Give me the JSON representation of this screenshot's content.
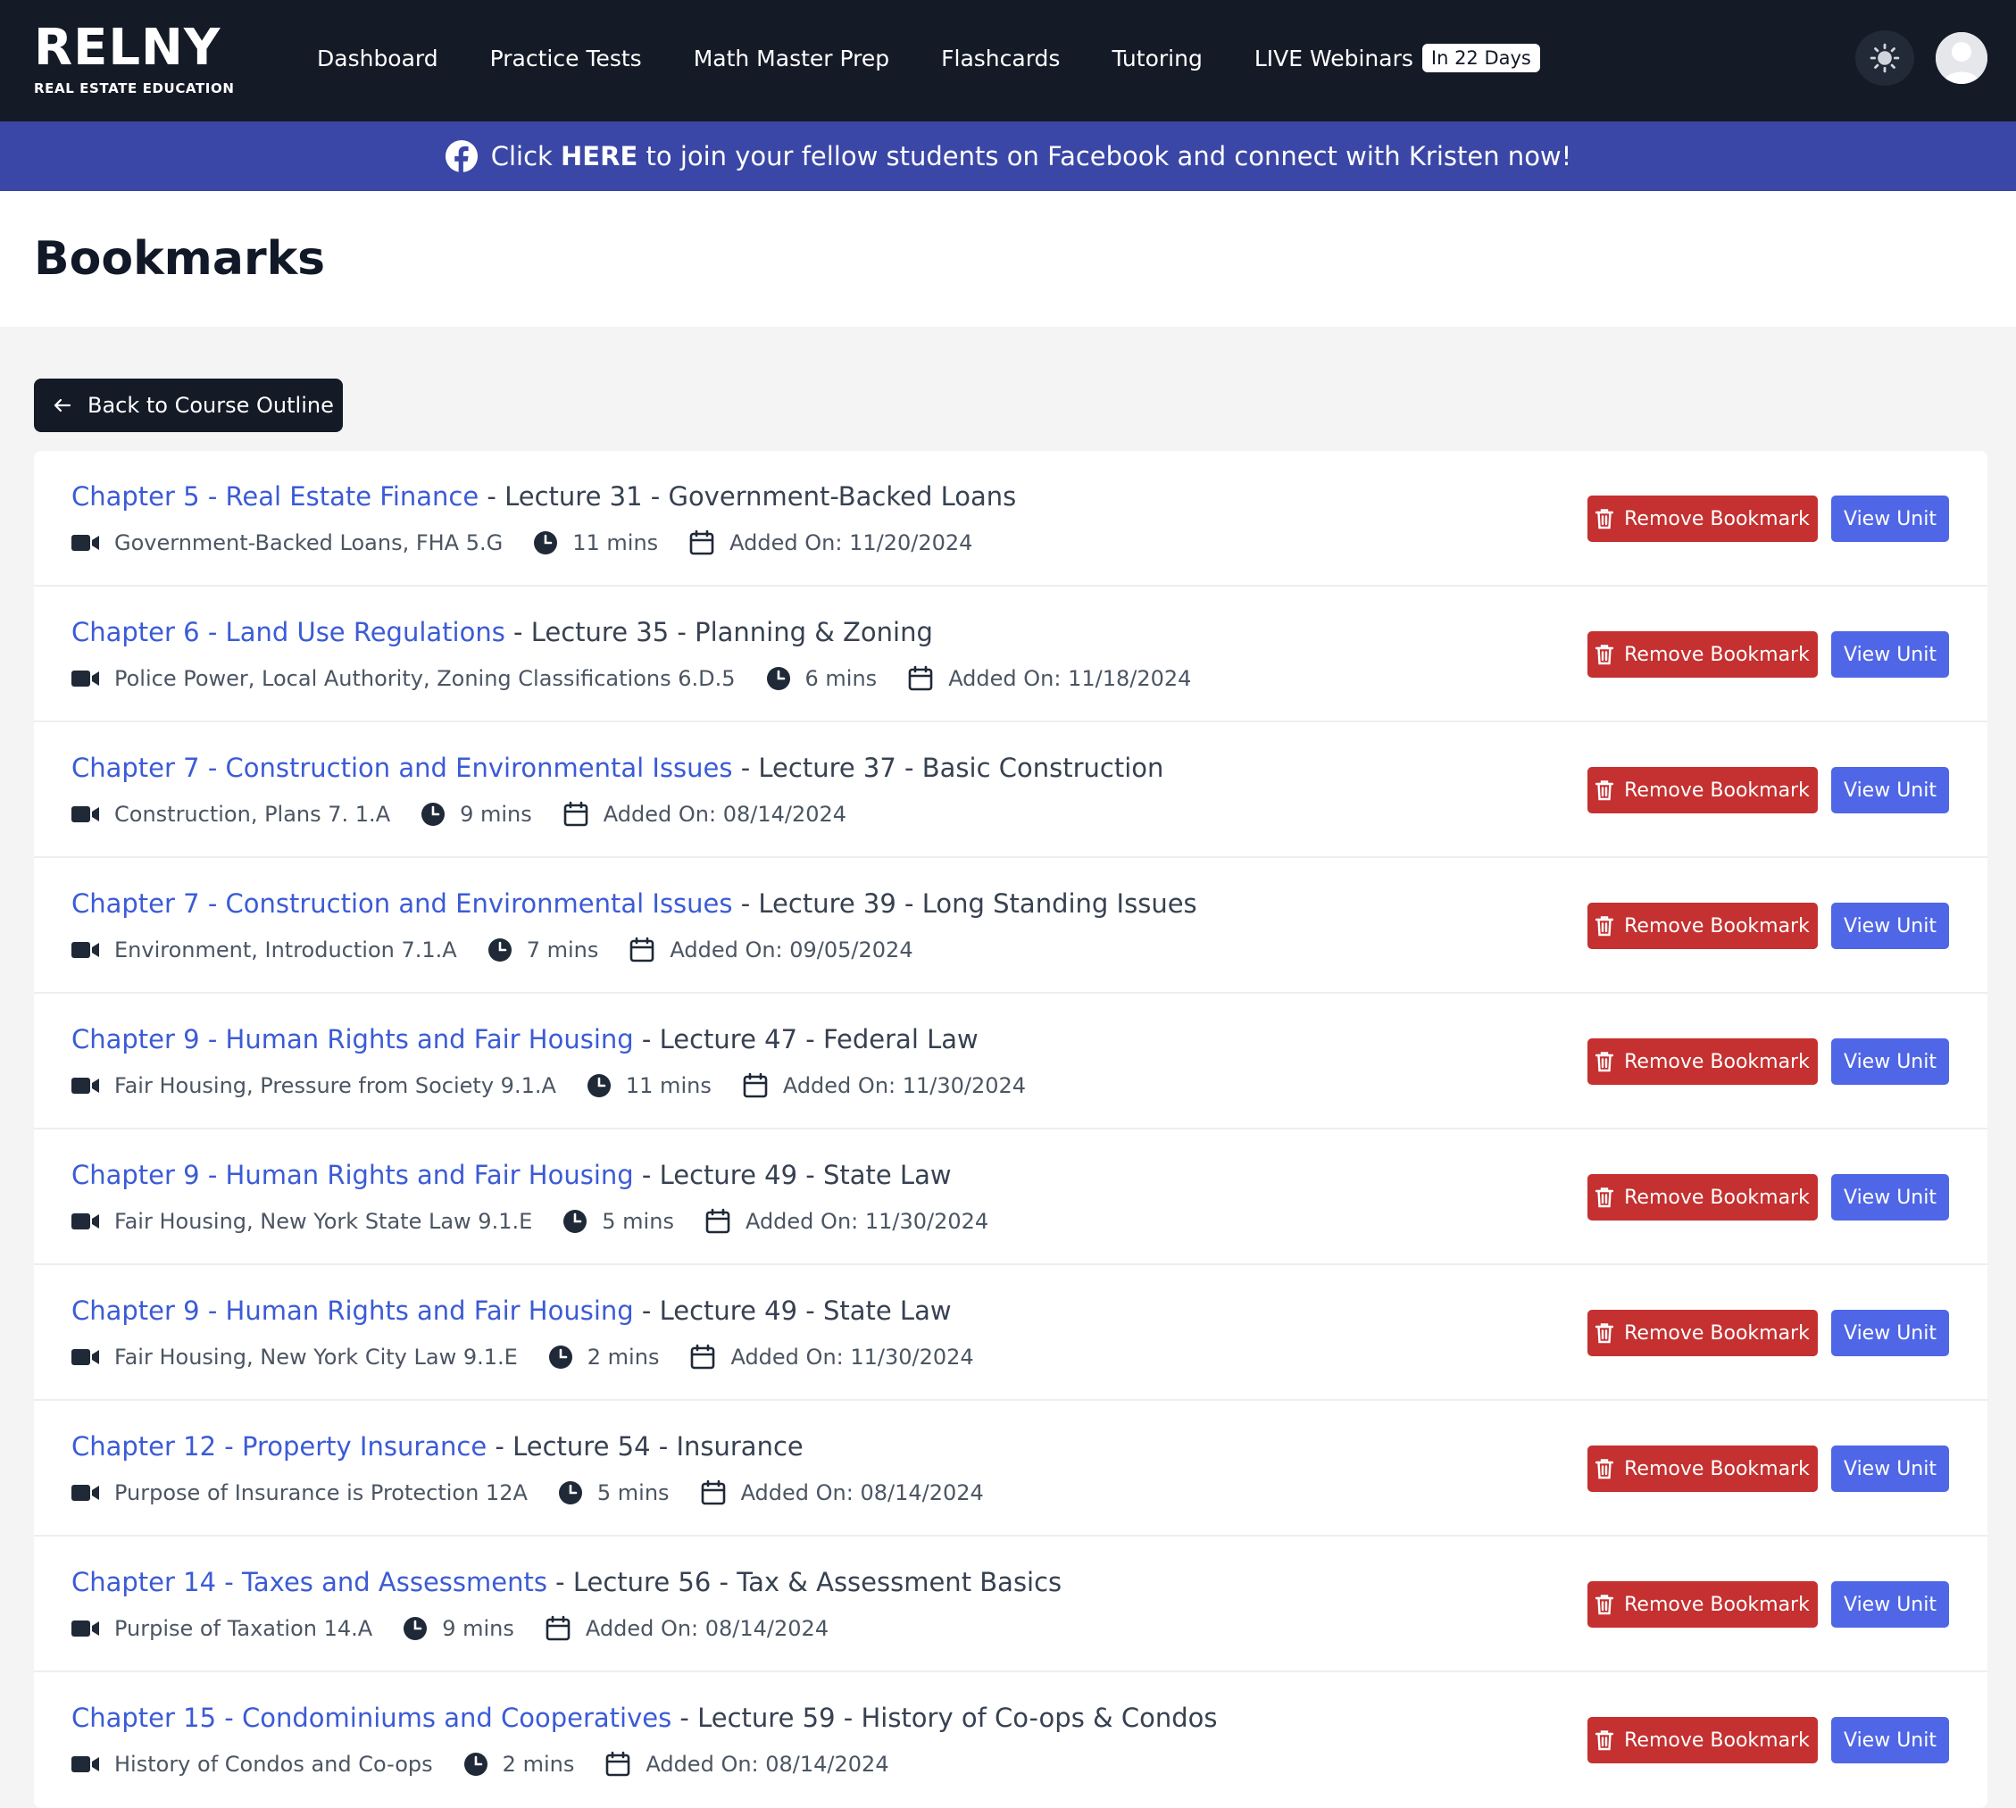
{
  "brand": {
    "name": "RELNY",
    "tagline": "REAL ESTATE EDUCATION"
  },
  "nav": {
    "links": [
      "Dashboard",
      "Practice Tests",
      "Math Master Prep",
      "Flashcards",
      "Tutoring"
    ],
    "live_label": "LIVE Webinars",
    "live_badge": "In 22 Days",
    "theme_icon": "sun-icon",
    "avatar_icon": "user-avatar-icon"
  },
  "banner": {
    "prefix": "Click ",
    "emphasis": "HERE",
    "suffix": " to join your fellow students on Facebook and connect with Kristen now!",
    "icon": "facebook-icon"
  },
  "page": {
    "title": "Bookmarks",
    "back_label": "Back to Course Outline"
  },
  "colors": {
    "navbar": "#141a26",
    "banner": "#3a47a6",
    "link": "#3b5bd6",
    "remove": "#c53030",
    "view": "#4f66e6"
  },
  "actions": {
    "remove_label": "Remove Bookmark",
    "view_label": "View Unit"
  },
  "bookmarks": [
    {
      "chapter": "Chapter 5",
      "chapter_name": "Real Estate Finance",
      "lecture": "Lecture 31",
      "lecture_name": "Government-Backed Loans",
      "video": "Government-Backed Loans, FHA 5.G",
      "duration": "11 mins",
      "added": "Added On: 11/20/2024"
    },
    {
      "chapter": "Chapter 6",
      "chapter_name": "Land Use Regulations",
      "lecture": "Lecture 35",
      "lecture_name": "Planning & Zoning",
      "video": "Police Power, Local Authority, Zoning Classifications 6.D.5",
      "duration": "6 mins",
      "added": "Added On: 11/18/2024"
    },
    {
      "chapter": "Chapter 7",
      "chapter_name": "Construction and Environmental Issues",
      "lecture": "Lecture 37",
      "lecture_name": "Basic Construction",
      "video": "Construction, Plans 7. 1.A",
      "duration": "9 mins",
      "added": "Added On: 08/14/2024"
    },
    {
      "chapter": "Chapter 7",
      "chapter_name": "Construction and Environmental Issues",
      "lecture": "Lecture 39",
      "lecture_name": "Long Standing Issues",
      "video": "Environment, Introduction 7.1.A",
      "duration": "7 mins",
      "added": "Added On: 09/05/2024"
    },
    {
      "chapter": "Chapter 9",
      "chapter_name": "Human Rights and Fair Housing",
      "lecture": "Lecture 47",
      "lecture_name": "Federal Law",
      "video": "Fair Housing, Pressure from Society 9.1.A",
      "duration": "11 mins",
      "added": "Added On: 11/30/2024"
    },
    {
      "chapter": "Chapter 9",
      "chapter_name": "Human Rights and Fair Housing",
      "lecture": "Lecture 49",
      "lecture_name": "State Law",
      "video": "Fair Housing, New York State Law 9.1.E",
      "duration": "5 mins",
      "added": "Added On: 11/30/2024"
    },
    {
      "chapter": "Chapter 9",
      "chapter_name": "Human Rights and Fair Housing",
      "lecture": "Lecture 49",
      "lecture_name": "State Law",
      "video": "Fair Housing, New York City Law 9.1.E",
      "duration": "2 mins",
      "added": "Added On: 11/30/2024"
    },
    {
      "chapter": "Chapter 12",
      "chapter_name": "Property Insurance",
      "lecture": "Lecture 54",
      "lecture_name": "Insurance",
      "video": "Purpose of Insurance is Protection 12A",
      "duration": "5 mins",
      "added": "Added On: 08/14/2024"
    },
    {
      "chapter": "Chapter 14",
      "chapter_name": "Taxes and Assessments",
      "lecture": "Lecture 56",
      "lecture_name": "Tax & Assessment Basics",
      "video": "Purpise of Taxation 14.A",
      "duration": "9 mins",
      "added": "Added On: 08/14/2024"
    },
    {
      "chapter": "Chapter 15",
      "chapter_name": "Condominiums and Cooperatives",
      "lecture": "Lecture 59",
      "lecture_name": "History of Co-ops & Condos",
      "video": "History of Condos and Co-ops",
      "duration": "2 mins",
      "added": "Added On: 08/14/2024"
    }
  ]
}
